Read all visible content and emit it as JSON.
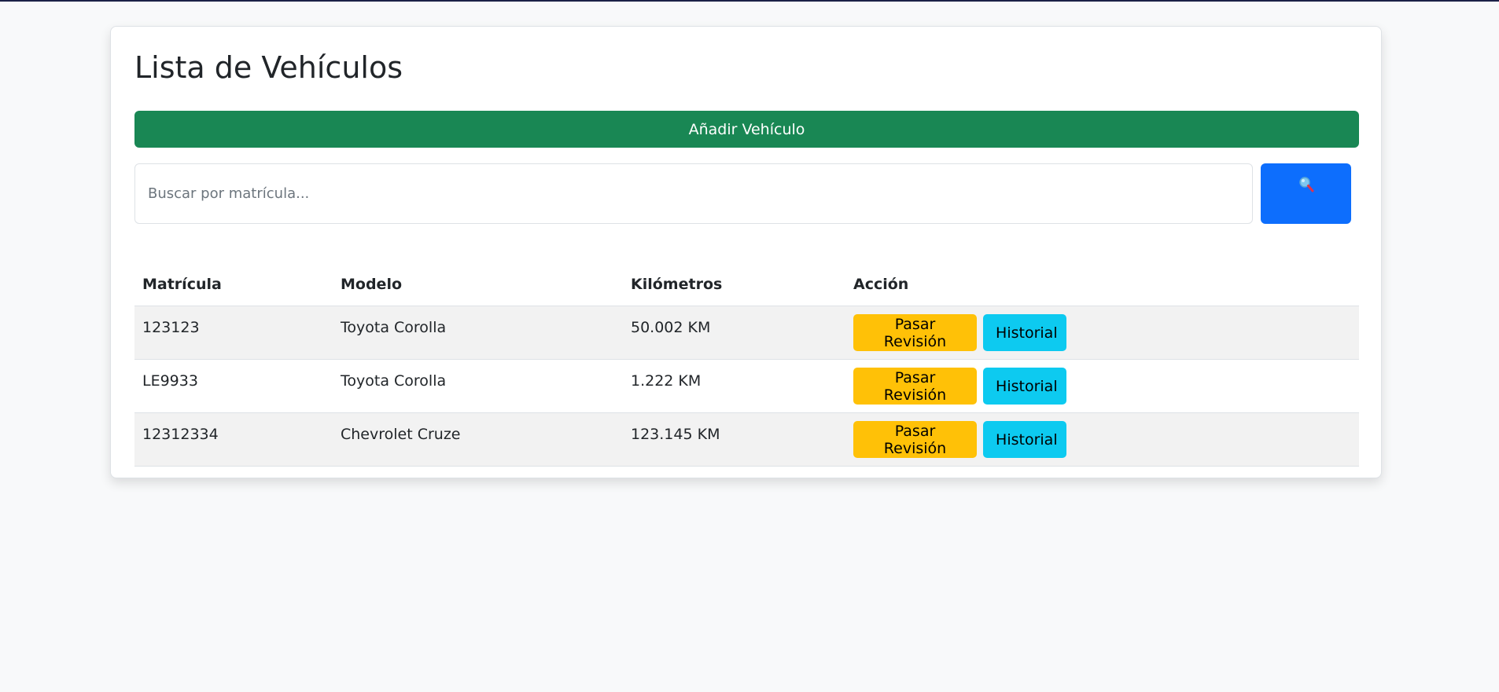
{
  "page": {
    "title": "Lista de Vehículos"
  },
  "toolbar": {
    "add_label": "Añadir Vehículo"
  },
  "search": {
    "placeholder": "Buscar por matrícula...",
    "value": "",
    "button_icon": "magnifier-icon"
  },
  "table": {
    "headers": [
      "Matrícula",
      "Modelo",
      "Kilómetros",
      "Acción"
    ],
    "rows": [
      {
        "plate": "123123",
        "model": "Toyota Corolla",
        "km": "50.002 KM",
        "review_label": "Pasar Revisión",
        "history_label": "Historial"
      },
      {
        "plate": "LE9933",
        "model": "Toyota Corolla",
        "km": "1.222 KM",
        "review_label": "Pasar Revisión",
        "history_label": "Historial"
      },
      {
        "plate": "12312334",
        "model": "Chevrolet Cruze",
        "km": "123.145 KM",
        "review_label": "Pasar Revisión",
        "history_label": "Historial"
      }
    ]
  },
  "colors": {
    "page_bg": "#f8f9fa",
    "add_button": "#198754",
    "search_button": "#0d6efd",
    "review_button": "#ffc107",
    "history_button": "#0dcaf0"
  }
}
